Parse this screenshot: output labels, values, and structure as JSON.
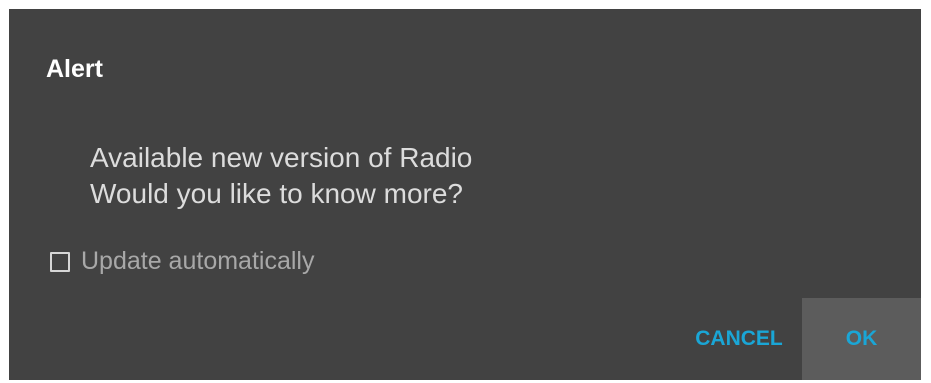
{
  "dialog": {
    "title": "Alert",
    "message_line1": "Available new version of Radio",
    "message_line2": "Would you like to know more?",
    "checkbox": {
      "label": "Update automatically",
      "checked": false
    },
    "buttons": {
      "cancel_label": "CANCEL",
      "ok_label": "OK"
    }
  },
  "colors": {
    "dialog_background": "#424242",
    "accent": "#1aa6d6",
    "ok_pressed_background": "#5c5c5c"
  }
}
